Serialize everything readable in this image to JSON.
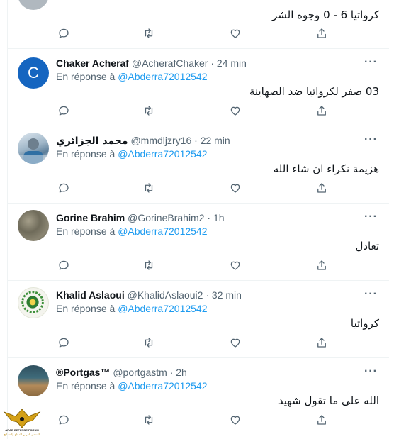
{
  "top_tweet": {
    "text": "كرواتيا 6 - 0 وجوه الشر"
  },
  "reply_prefix": "En réponse à",
  "tweets": [
    {
      "avatar_letter": "C",
      "avatar_color": "#1565c0",
      "name": "Chaker Acheraf",
      "handle": "@AcherafChaker",
      "time": "24 min",
      "mention": "@Abderra72012542",
      "text": "03 صفر لكرواتيا ضد الصهاينة"
    },
    {
      "name": "محمد الجزائري",
      "handle": "@mmdljzry16",
      "time": "22 min",
      "mention": "@Abderra72012542",
      "text": "هزيمة نكراء ان شاء الله"
    },
    {
      "name": "Gorine Brahim",
      "handle": "@GorineBrahim2",
      "time": "1h",
      "mention": "@Abderra72012542",
      "text": "تعادل"
    },
    {
      "name": "Khalid Aslaoui",
      "handle": "@KhalidAslaoui2",
      "time": "32 min",
      "mention": "@Abderra72012542",
      "text": "كرواتيا"
    },
    {
      "name": "®Portgas™",
      "handle": "@portgastm",
      "time": "2h",
      "mention": "@Abderra72012542",
      "text": "الله على ما تقول شهيد"
    }
  ],
  "separator": "·",
  "more_label": "···",
  "watermark": {
    "line1": "ARAB DEFENSE FORUM",
    "line2": "المنتدى العربي للدفاع والتسليح"
  }
}
